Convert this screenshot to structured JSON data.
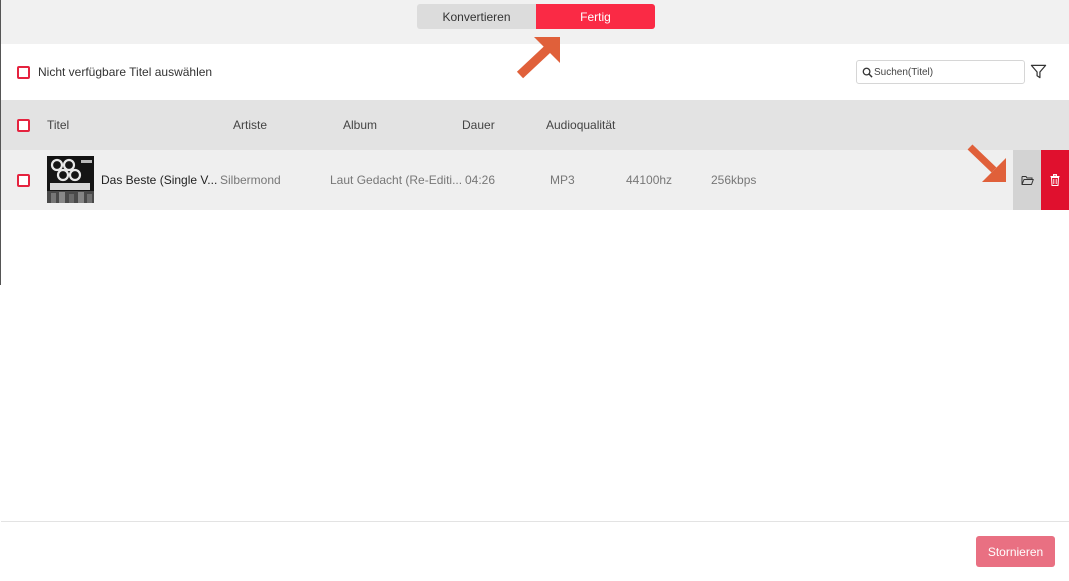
{
  "tabs": {
    "convert_label": "Konvertieren",
    "done_label": "Fertig"
  },
  "options": {
    "select_unavailable_label": "Nicht verfügbare Titel auswählen"
  },
  "search": {
    "placeholder": "Suchen(Titel)",
    "value": ""
  },
  "table": {
    "headers": [
      "Titel",
      "Artiste",
      "Album",
      "Dauer",
      "Audioqualität"
    ],
    "rows": [
      {
        "title": "Das Beste (Single V...",
        "artist": "Silbermond",
        "album": "Laut Gedacht (Re-Editi...",
        "duration": "04:26",
        "format": "MP3",
        "sample_rate": "44100hz",
        "bitrate": "256kbps"
      }
    ]
  },
  "footer": {
    "cancel_label": "Stornieren"
  },
  "colors": {
    "accent": "#fa2a45",
    "delete": "#e0102e",
    "annotation_arrow": "#e0603a",
    "cancel_button": "#e97082"
  },
  "icons": {
    "search": "search-icon",
    "filter": "filter-icon",
    "folder": "folder-open-icon",
    "delete": "trash-icon"
  }
}
